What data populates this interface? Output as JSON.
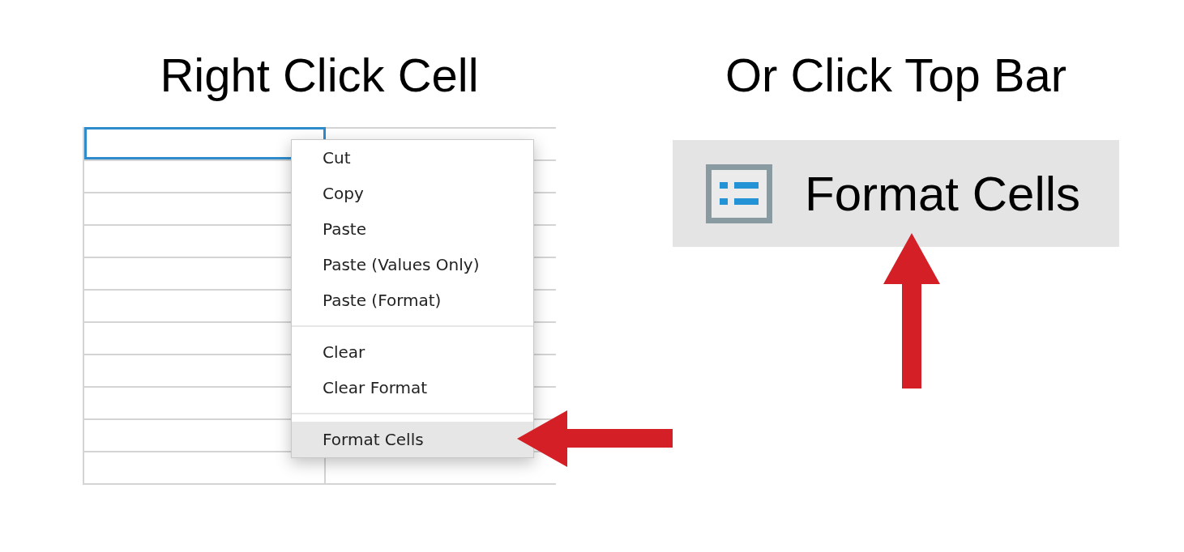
{
  "context_menu_demo": {
    "title": "Right Click Cell",
    "grid": {
      "rows": [
        {
          "cells": [
            {
              "selected": true
            },
            {
              "selected": false
            }
          ]
        },
        {
          "cells": [
            {
              "selected": false
            },
            {
              "selected": false
            }
          ]
        },
        {
          "cells": [
            {
              "selected": false
            },
            {
              "selected": false
            }
          ]
        },
        {
          "cells": [
            {
              "selected": false
            },
            {
              "selected": false
            }
          ]
        },
        {
          "cells": [
            {
              "selected": false
            },
            {
              "selected": false
            }
          ]
        },
        {
          "cells": [
            {
              "selected": false
            },
            {
              "selected": false
            }
          ]
        },
        {
          "cells": [
            {
              "selected": false
            },
            {
              "selected": false
            }
          ]
        },
        {
          "cells": [
            {
              "selected": false
            },
            {
              "selected": false
            }
          ]
        },
        {
          "cells": [
            {
              "selected": false
            },
            {
              "selected": false
            }
          ]
        },
        {
          "cells": [
            {
              "selected": false
            },
            {
              "selected": false
            }
          ]
        },
        {
          "cells": [
            {
              "selected": false
            },
            {
              "selected": false
            }
          ]
        }
      ]
    },
    "menu": {
      "groups": [
        {
          "items": [
            {
              "label": "Cut",
              "selected": false
            },
            {
              "label": "Copy",
              "selected": false
            },
            {
              "label": "Paste",
              "selected": false
            },
            {
              "label": "Paste (Values Only)",
              "selected": false
            },
            {
              "label": "Paste (Format)",
              "selected": false
            }
          ]
        },
        {
          "items": [
            {
              "label": "Clear",
              "selected": false
            },
            {
              "label": "Clear Format",
              "selected": false
            }
          ]
        },
        {
          "items": [
            {
              "label": "Format Cells",
              "selected": true
            }
          ]
        }
      ]
    }
  },
  "toolbar_demo": {
    "title": "Or Click Top Bar",
    "button": {
      "label": "Format Cells"
    }
  }
}
